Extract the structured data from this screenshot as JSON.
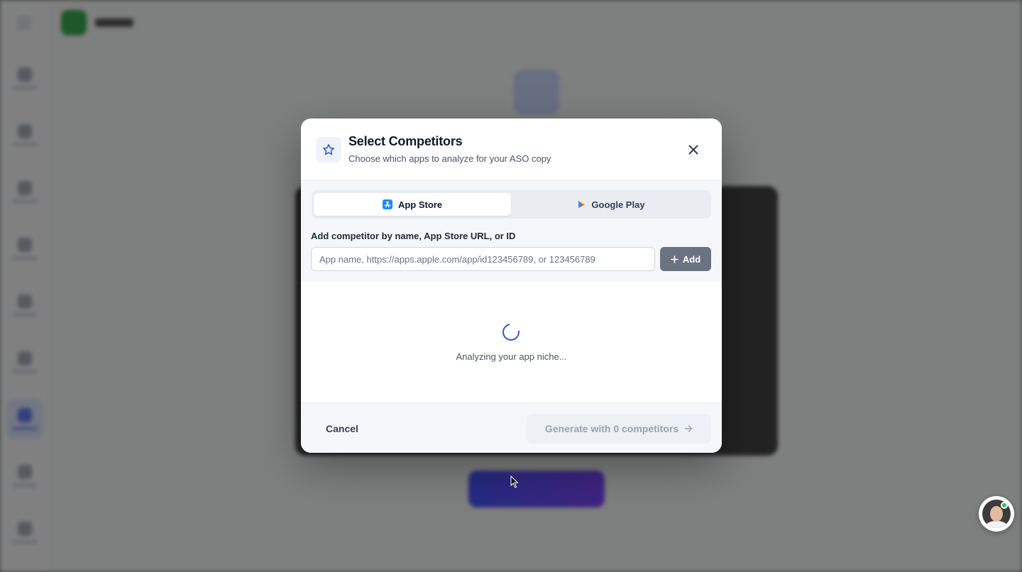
{
  "modal": {
    "title": "Select Competitors",
    "subtitle": "Choose which apps to analyze for your ASO copy",
    "header_icon": "star-icon",
    "close_icon": "close-icon"
  },
  "tabs": [
    {
      "label": "App Store",
      "icon": "app-store-icon",
      "active": true
    },
    {
      "label": "Google Play",
      "icon": "google-play-icon",
      "active": false
    }
  ],
  "add_competitor": {
    "label": "Add competitor by name, App Store URL, or ID",
    "placeholder": "App name, https://apps.apple.com/app/id123456789, or 123456789",
    "value": "",
    "button_label": "Add",
    "button_icon": "plus-icon"
  },
  "loading": {
    "text": "Analyzing your app niche..."
  },
  "footer": {
    "cancel_label": "Cancel",
    "generate_label": "Generate with 0 competitors",
    "generate_icon": "arrow-right-icon"
  },
  "colors": {
    "accent": "#2f56d8",
    "add_button": "#6b7380",
    "overlay": "#1e1e1e",
    "online": "#22c55e"
  }
}
